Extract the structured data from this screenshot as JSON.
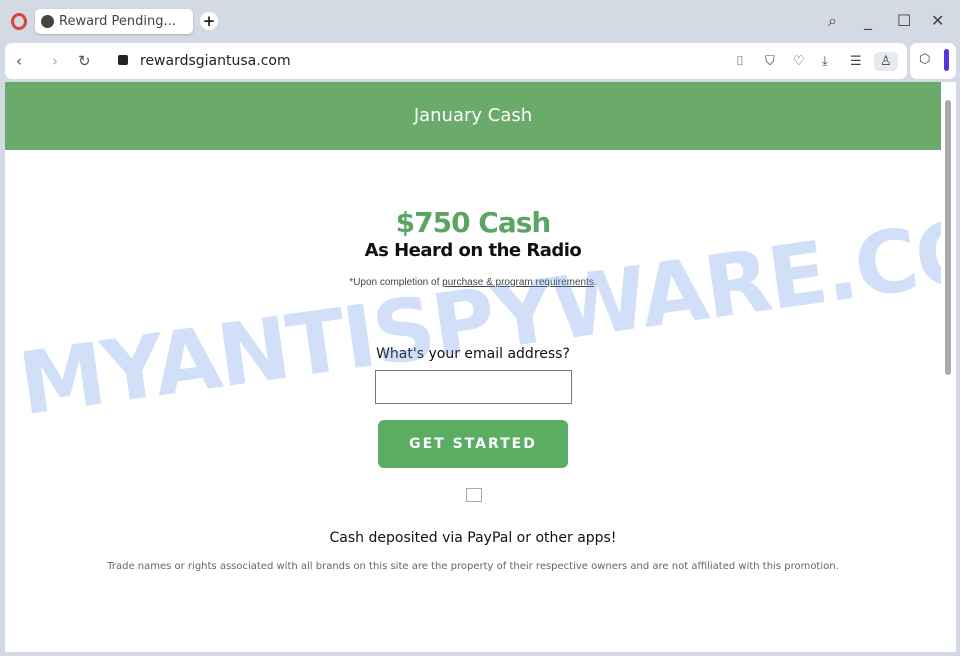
{
  "browser": {
    "tab_title": "Reward Pending...",
    "url": "rewardsgiantusa.com"
  },
  "page": {
    "header": "January Cash",
    "price": "$750 Cash",
    "subtitle": "As Heard on the Radio",
    "note_prefix": "*Upon completion of ",
    "note_link": "purchase & program requirements",
    "note_suffix": ".",
    "email_question": "What's your email address?",
    "email_value": "",
    "button": "GET STARTED",
    "deposit": "Cash deposited via PayPal or other apps!",
    "disclaimer": "Trade names or rights associated with all brands on this site are the property of their respective owners and are not affiliated with this promotion."
  },
  "watermark": "MYANTISPYWARE.COM",
  "colors": {
    "header": "#6aaa6a",
    "accent": "#5aa564",
    "button": "#5aad62"
  }
}
